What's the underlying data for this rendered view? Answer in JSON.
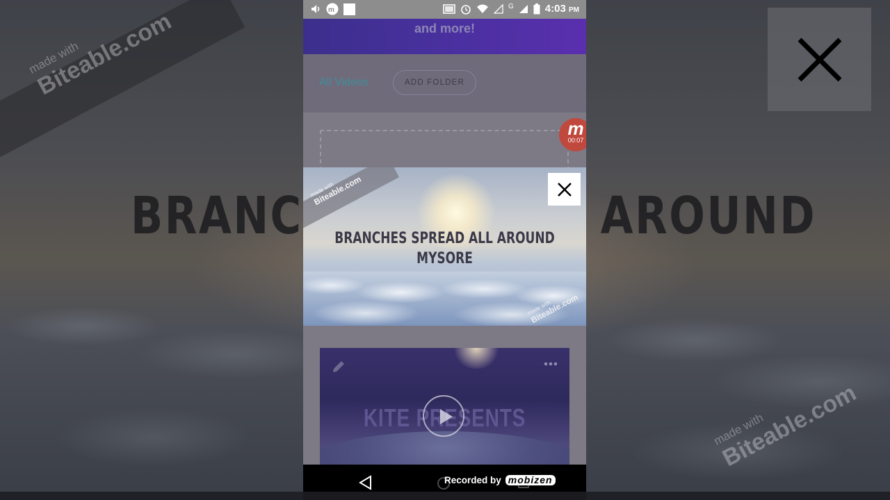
{
  "background": {
    "heading_left": "BRANCHE",
    "heading_right": "AROUND",
    "watermark": {
      "small": "made with",
      "brand": "Biteable.com"
    }
  },
  "status_bar": {
    "time": "4:03",
    "ampm": "PM",
    "network_letter": "G"
  },
  "banner": {
    "text": "and more!"
  },
  "videos_bar": {
    "all_videos_label": "All Videos",
    "add_folder_label": "ADD FOLDER"
  },
  "recording_badge": {
    "letter": "m",
    "timer": "00:07"
  },
  "preview": {
    "title_line1": "BRANCHES SPREAD ALL AROUND",
    "title_line2": "MYSORE",
    "watermark_small": "made with",
    "watermark_brand": "Biteable.com"
  },
  "video_card": {
    "title": "KITE PRESENTS"
  },
  "nav_bar": {
    "recorded_by_label": "Recorded by",
    "recorder_brand": "mobizen"
  },
  "colors": {
    "banner_start": "#3c2f8c",
    "banner_end": "#5a2fae",
    "tab_accent": "#3f8e9a",
    "record_red": "#c0483d"
  },
  "icons": [
    "volume-icon",
    "mobizen-status-icon",
    "square-notification-icon",
    "cast-icon",
    "alarm-icon",
    "wifi-icon",
    "signal-icon",
    "battery-icon",
    "close-icon",
    "edit-pencil-icon",
    "more-dots-icon",
    "play-icon",
    "back-icon",
    "home-icon",
    "recents-icon"
  ]
}
